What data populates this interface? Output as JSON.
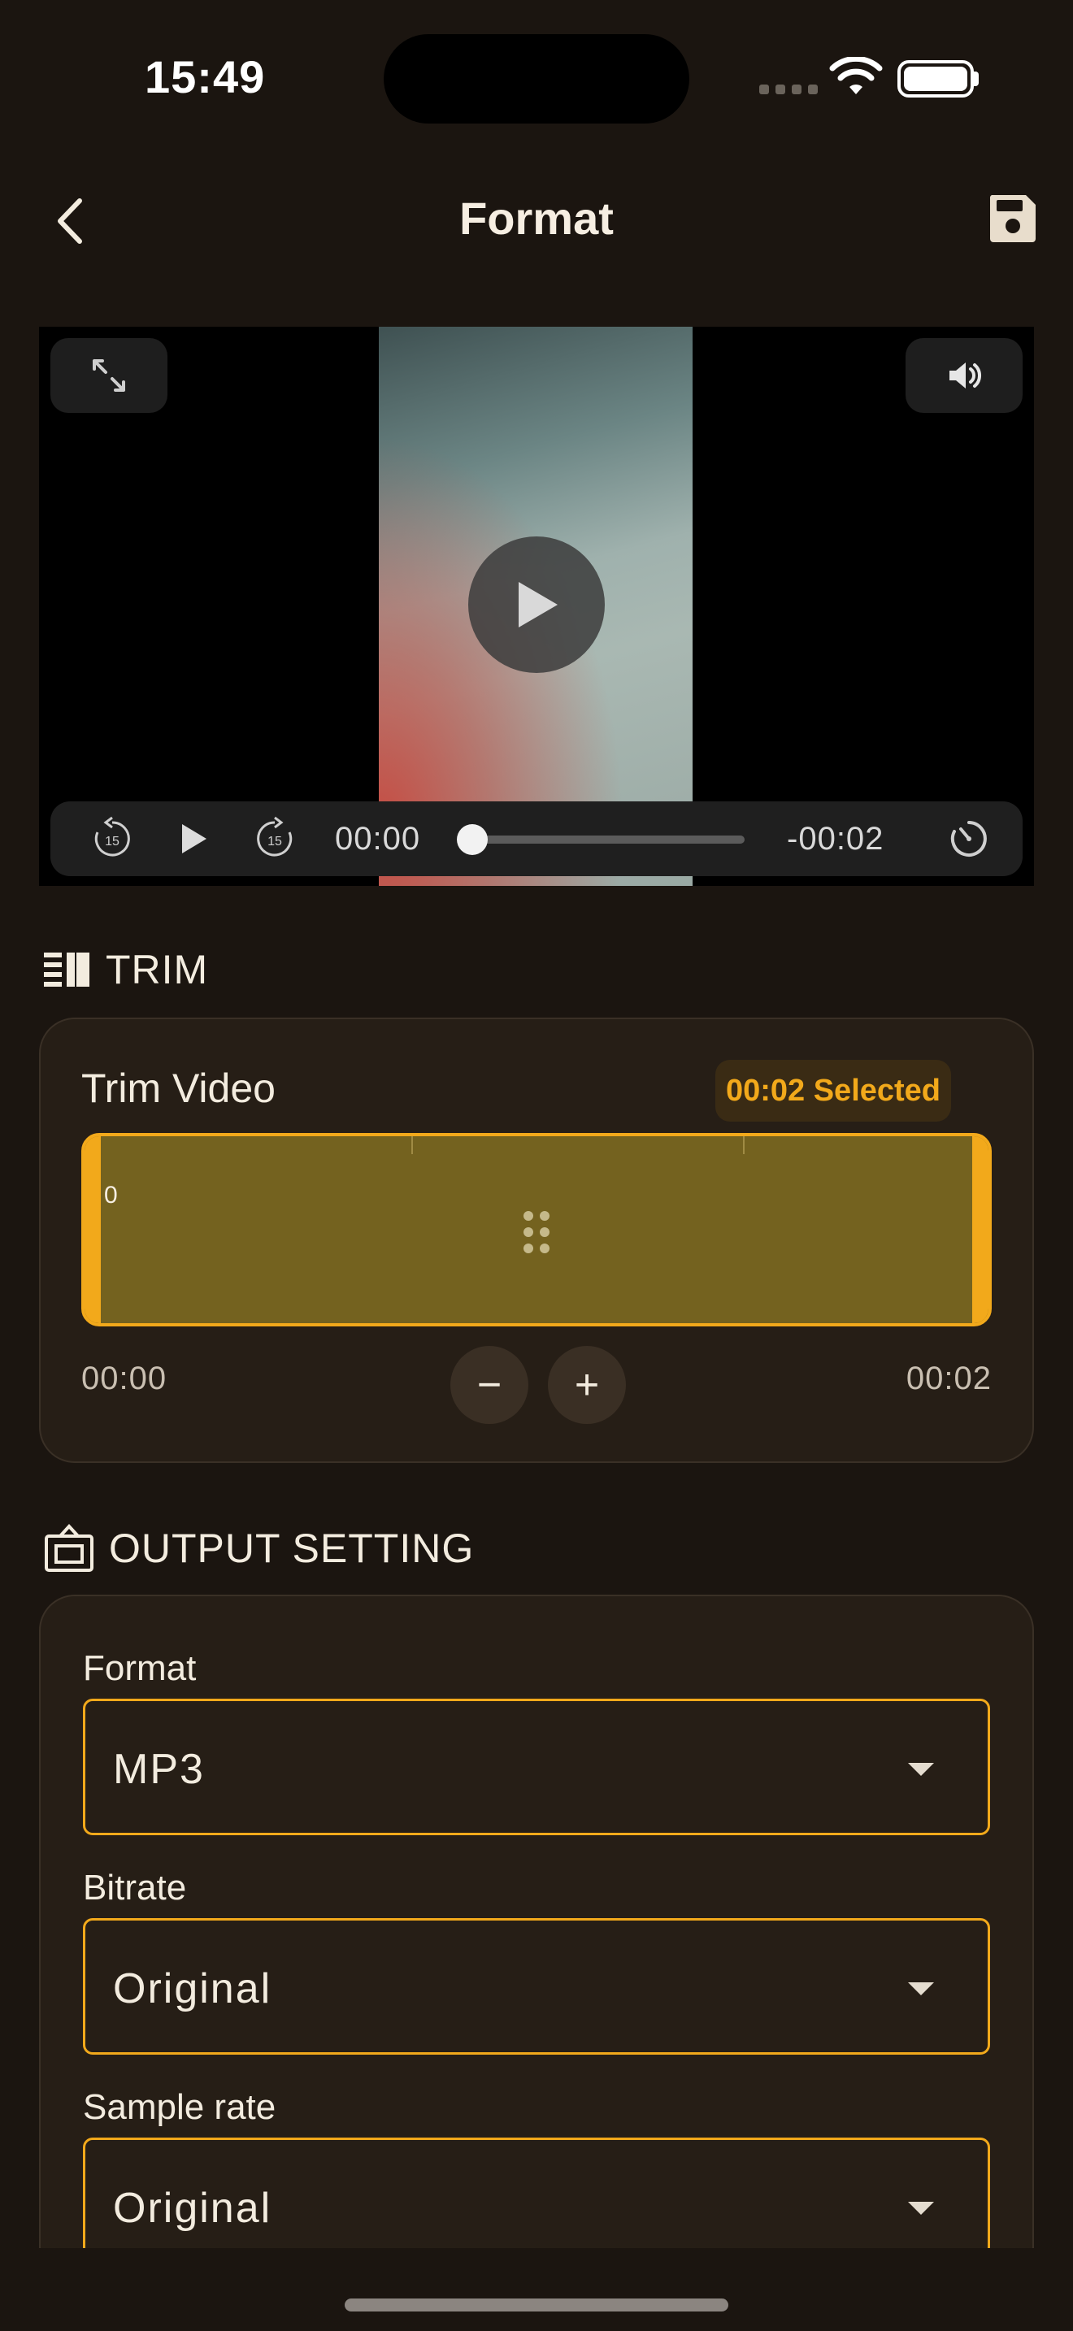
{
  "status": {
    "time": "15:49"
  },
  "nav": {
    "title": "Format",
    "back_icon": "chevron-left-icon",
    "save_icon": "floppy-disk-icon"
  },
  "video": {
    "current_time": "00:00",
    "remaining_time": "-00:02",
    "skip_back_label": "15",
    "skip_forward_label": "15",
    "progress": 0.0
  },
  "trim": {
    "section_title": "TRIM",
    "card_title": "Trim Video",
    "selected_badge": "00:02 Selected",
    "zero_marker": "0",
    "start_time": "00:00",
    "end_time": "00:02",
    "minus_label": "−",
    "plus_label": "+"
  },
  "output": {
    "section_title": "OUTPUT SETTING",
    "fields": [
      {
        "label": "Format",
        "value": "MP3"
      },
      {
        "label": "Bitrate",
        "value": "Original"
      },
      {
        "label": "Sample rate",
        "value": "Original"
      }
    ]
  },
  "colors": {
    "accent": "#f2a91b",
    "background": "#1b1510",
    "card": "#261e16",
    "trim_fill": "#74621f"
  }
}
